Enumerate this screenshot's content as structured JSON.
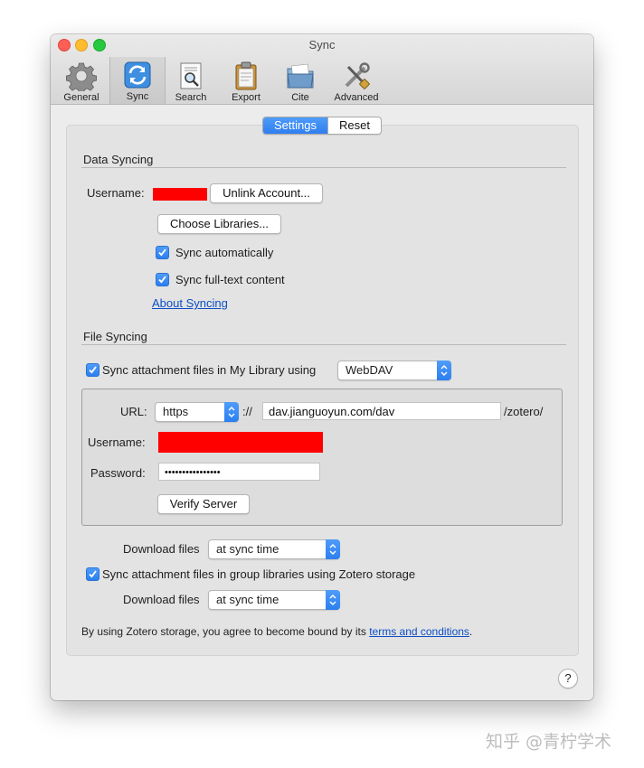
{
  "window": {
    "title": "Sync"
  },
  "toolbar": {
    "items": [
      {
        "label": "General",
        "icon": "gear-icon"
      },
      {
        "label": "Sync",
        "icon": "sync-icon"
      },
      {
        "label": "Search",
        "icon": "search-icon"
      },
      {
        "label": "Export",
        "icon": "clipboard-icon"
      },
      {
        "label": "Cite",
        "icon": "folder-icon"
      },
      {
        "label": "Advanced",
        "icon": "tools-icon"
      }
    ],
    "active": "Sync"
  },
  "tabs": {
    "settings": "Settings",
    "reset": "Reset"
  },
  "data_syncing": {
    "title": "Data Syncing",
    "username_label": "Username:",
    "unlink_button": "Unlink Account...",
    "choose_libraries_button": "Choose Libraries...",
    "sync_automatically": "Sync automatically",
    "sync_fulltext": "Sync full-text content",
    "about_link": "About Syncing"
  },
  "file_syncing": {
    "title": "File Syncing",
    "sync_my_library": "Sync attachment files in My Library using",
    "method_value": "WebDAV",
    "url_label": "URL:",
    "protocol_value": "https",
    "separator": "://",
    "url_value": "dav.jianguoyun.com/dav",
    "url_suffix": "/zotero/",
    "username_label": "Username:",
    "password_label": "Password:",
    "password_value": "••••••••••••••••",
    "verify_button": "Verify Server",
    "download_label_1": "Download files",
    "download_value_1": "at sync time",
    "sync_group": "Sync attachment files in group libraries using Zotero storage",
    "download_label_2": "Download files",
    "download_value_2": "at sync time",
    "footer_text": "By using Zotero storage, you agree to become bound by its ",
    "footer_link": "terms and conditions",
    "footer_end": "."
  },
  "help": "?",
  "watermark": "知乎 @青柠学术",
  "colors": {
    "accent": "#2f7ef0",
    "redaction": "#fe0000",
    "link": "#0d4fc4"
  }
}
